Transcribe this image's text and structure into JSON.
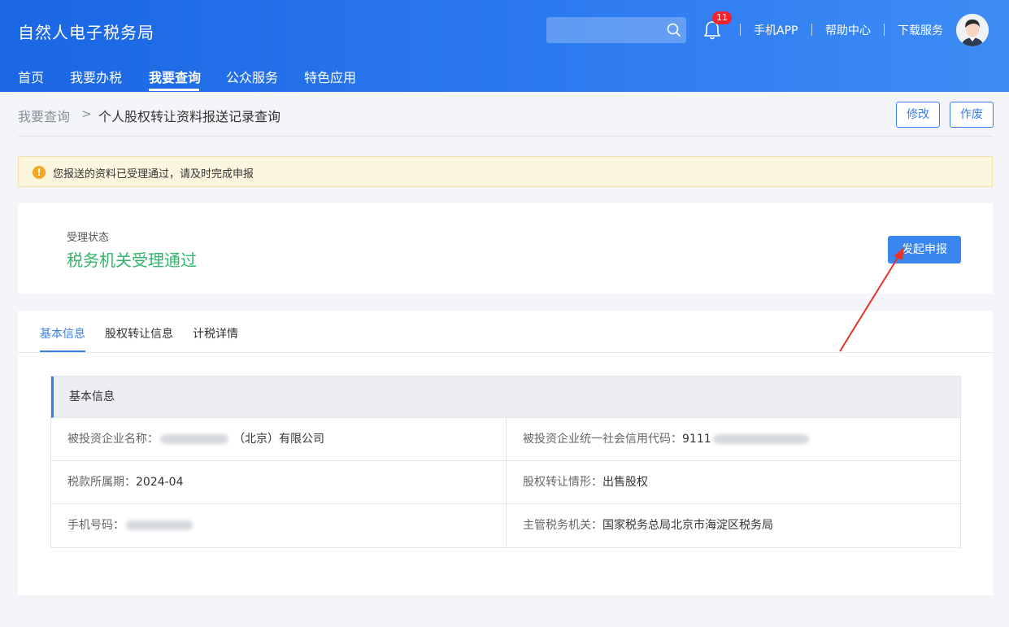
{
  "header": {
    "title": "自然人电子税务局",
    "search": {
      "placeholder": ""
    },
    "notifications": {
      "count": "11"
    },
    "links": {
      "app": "手机APP",
      "help": "帮助中心",
      "download": "下载服务"
    },
    "nav": [
      "首页",
      "我要办税",
      "我要查询",
      "公众服务",
      "特色应用"
    ]
  },
  "breadcrumb": {
    "parent": "我要查询",
    "separator": ">",
    "current": "个人股权转让资料报送记录查询"
  },
  "actions": {
    "modify": "修改",
    "void": "作废"
  },
  "alert": {
    "text": "您报送的资料已受理通过，请及时完成申报"
  },
  "status": {
    "label": "受理状态",
    "value": "税务机关受理通过",
    "button": "发起申报"
  },
  "tabs": [
    "基本信息",
    "股权转让信息",
    "计税详情"
  ],
  "info": {
    "title": "基本信息",
    "company_name_label": "被投资企业名称：",
    "company_name_suffix": "（北京）有限公司",
    "credit_code_label": "被投资企业统一社会信用代码：",
    "credit_code_prefix": "9111",
    "period_label": "税款所属期：",
    "period_value": "2024-04",
    "transfer_type_label": "股权转让情形：",
    "transfer_type_value": "出售股权",
    "phone_label": "手机号码：",
    "authority_label": "主管税务机关：",
    "authority_value": "国家税务总局北京市海淀区税务局"
  },
  "colors": {
    "primary": "#3a7fe8",
    "success": "#33b46b",
    "warning": "#f5a623",
    "annotation": "#e8322b"
  }
}
